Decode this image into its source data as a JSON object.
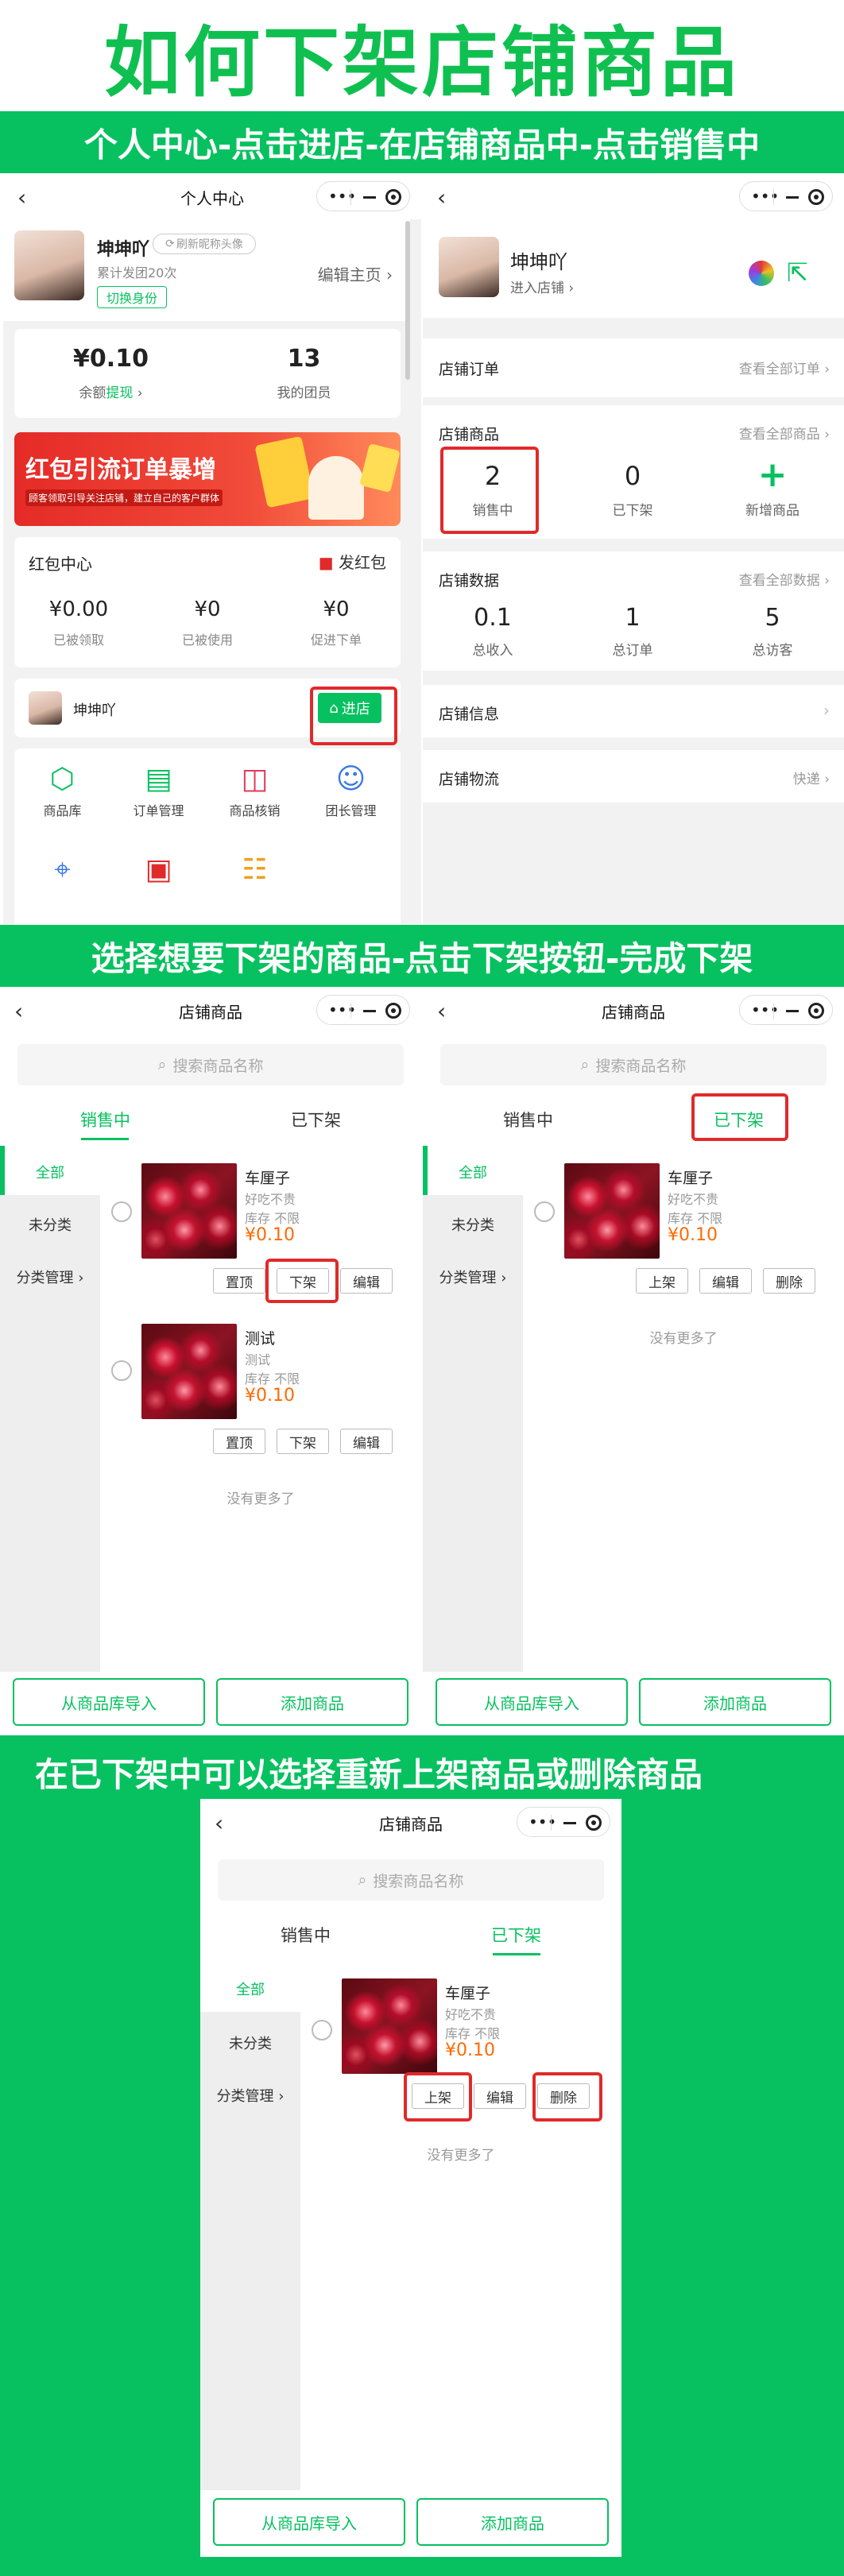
{
  "title": "如何下架店铺商品",
  "banner1": "个人中心-点击进店-在店铺商品中-点击销售中",
  "banner2": "选择想要下架的商品-点击下架按钮-完成下架",
  "banner3": "在已下架中可以选择重新上架商品或删除商品",
  "colors": {
    "accent": "#07c160",
    "highlight": "#e02a2a",
    "price": "#ff6a00"
  },
  "p1": {
    "nav_title": "个人中心",
    "user_name": "坤坤吖",
    "refresh_label": "刷新昵称头像",
    "sub": "累计发团20次",
    "edit_label": "编辑主页",
    "switch_label": "切换身份",
    "balance": "¥0.10",
    "balance_label": "余额",
    "withdraw": "提现",
    "members": "13",
    "members_label": "我的团员",
    "ad_title": "红包引流订单暴增",
    "ad_sub": "顾客领取引导关注店铺，建立自己的客户群体",
    "redpack_title": "红包中心",
    "send_redpack": "发红包",
    "stats": [
      {
        "value": "¥0.00",
        "label": "已被领取"
      },
      {
        "value": "¥0",
        "label": "已被使用"
      },
      {
        "value": "¥0",
        "label": "促进下单"
      }
    ],
    "shop_name": "坤坤吖",
    "enter_shop": "进店",
    "grid": [
      {
        "icon": "cube-icon",
        "label": "商品库"
      },
      {
        "icon": "order-doc-icon",
        "label": "订单管理"
      },
      {
        "icon": "bag-icon",
        "label": "商品核销"
      },
      {
        "icon": "leader-icon",
        "label": "团长管理"
      }
    ],
    "grid_row2": [
      {
        "icon": "location-icon"
      },
      {
        "icon": "id-card-icon"
      },
      {
        "icon": "group-icon"
      }
    ]
  },
  "p2": {
    "user_name": "坤坤吖",
    "enter_shop": "进入店铺",
    "orders_title": "店铺订单",
    "orders_link": "查看全部订单",
    "goods_title": "店铺商品",
    "goods_link": "查看全部商品",
    "goods_stats": [
      {
        "value": "2",
        "label": "销售中"
      },
      {
        "value": "0",
        "label": "已下架"
      },
      {
        "value": "+",
        "label": "新增商品"
      }
    ],
    "data_title": "店铺数据",
    "data_link": "查看全部数据",
    "data_stats": [
      {
        "value": "0.1",
        "label": "总收入"
      },
      {
        "value": "1",
        "label": "总订单"
      },
      {
        "value": "5",
        "label": "总访客"
      }
    ],
    "info_title": "店铺信息",
    "logistics_title": "店铺物流",
    "logistics_value": "快递"
  },
  "shop": {
    "nav_title": "店铺商品",
    "search_placeholder": "搜索商品名称",
    "tab_on": "销售中",
    "tab_off": "已下架",
    "side": [
      "全部",
      "未分类",
      "分类管理"
    ],
    "no_more": "没有更多了",
    "import_btn": "从商品库导入",
    "add_btn": "添加商品"
  },
  "goods": [
    {
      "name": "车厘子",
      "desc": "好吃不贵",
      "stock": "库存 不限",
      "price": "¥0.10"
    },
    {
      "name": "测试",
      "desc": "测试",
      "stock": "库存 不限",
      "price": "¥0.10"
    }
  ],
  "btns": {
    "top": "置顶",
    "off": "下架",
    "edit": "编辑",
    "on": "上架",
    "del": "删除"
  }
}
